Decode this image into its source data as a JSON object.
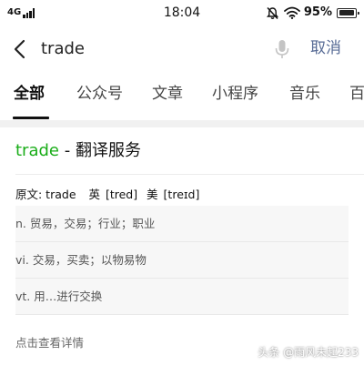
{
  "status_bar": {
    "network": "4G",
    "time": "18:04",
    "battery": "95%"
  },
  "search": {
    "query": "trade",
    "cancel_label": "取消"
  },
  "tabs": [
    {
      "label": "全部",
      "active": true
    },
    {
      "label": "公众号"
    },
    {
      "label": "文章"
    },
    {
      "label": "小程序"
    },
    {
      "label": "音乐"
    },
    {
      "label": "百"
    }
  ],
  "result": {
    "word": "trade",
    "title_suffix": " - 翻译服务",
    "original_label": "原文: trade",
    "uk_label": "英",
    "uk_phonetic": "[tred]",
    "us_label": "美",
    "us_phonetic": "[treɪd]",
    "definitions": [
      "n. 贸易，交易；行业；职业",
      "vi. 交易，买卖；以物易物",
      "vt. 用…进行交换"
    ],
    "details_link": "点击查看详情"
  },
  "watermark": "头条 @雨风未起233",
  "colors": {
    "accent_green": "#1aad19",
    "link_blue": "#576b95"
  },
  "icons": [
    "back-icon",
    "microphone-icon",
    "mute-icon",
    "wifi-icon",
    "battery-icon"
  ]
}
